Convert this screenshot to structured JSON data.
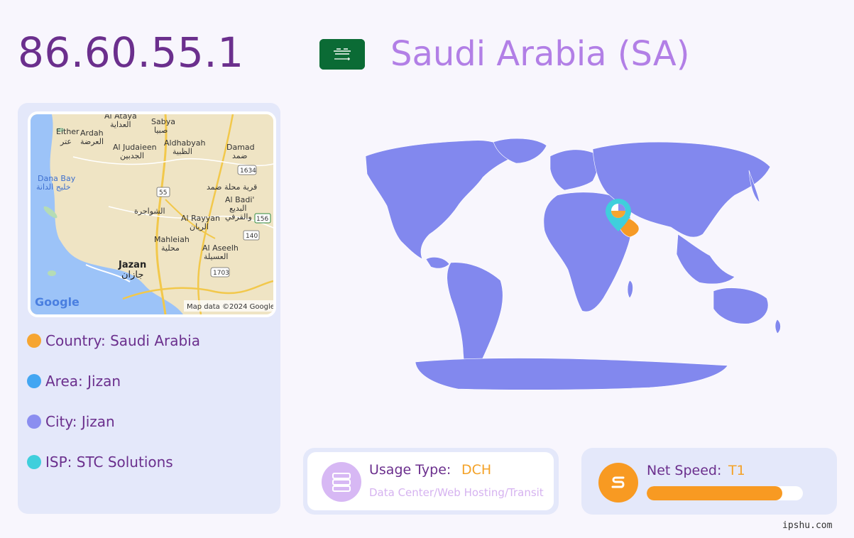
{
  "header": {
    "ip": "86.60.55.1",
    "country_title": "Saudi Arabia (SA)",
    "flag_icon": "saudi-arabia-flag"
  },
  "details": {
    "country": "Country: Saudi Arabia",
    "area": "Area: Jizan",
    "city": "City: Jizan",
    "isp": "ISP: STC Solutions"
  },
  "colors": {
    "country_dot": "#f6a531",
    "area_dot": "#43a6f2",
    "city_dot": "#8b8ef0",
    "isp_dot": "#3fcfdc",
    "world_land": "#8288ee",
    "highlight": "#f69a25",
    "accent_purple": "#6b2f8d"
  },
  "map": {
    "labels": [
      {
        "text": "Al Ataya",
        "id": "al-ataya"
      },
      {
        "text": "العداية",
        "id": "al-ataya-ar"
      },
      {
        "text": "Sabya",
        "id": "sabya"
      },
      {
        "text": "صبيا",
        "id": "sabya-ar"
      },
      {
        "text": "Either",
        "id": "either"
      },
      {
        "text": "Ardah",
        "id": "ardah"
      },
      {
        "text": "عتر",
        "id": "either-ar"
      },
      {
        "text": "العرضة",
        "id": "ardah-ar"
      },
      {
        "text": "Al Judaieen",
        "id": "al-judaieen"
      },
      {
        "text": "الجدبين",
        "id": "al-judaieen-ar"
      },
      {
        "text": "Aldhabyah",
        "id": "aldhabyah"
      },
      {
        "text": "الظبية",
        "id": "aldhabyah-ar"
      },
      {
        "text": "Damad",
        "id": "damad"
      },
      {
        "text": "ضمد",
        "id": "damad-ar"
      },
      {
        "text": "Dana Bay",
        "id": "dana-bay"
      },
      {
        "text": "خليج الدانة",
        "id": "dana-bay-ar"
      },
      {
        "text": "قرية محلة ضمد",
        "id": "qaryat-ar"
      },
      {
        "text": "Al Badi'",
        "id": "al-badi"
      },
      {
        "text": "البديع",
        "id": "al-badi-ar"
      },
      {
        "text": "والقرفي",
        "id": "al-qarfi-ar"
      },
      {
        "text": "الشواجرة",
        "id": "shawajira-ar"
      },
      {
        "text": "Al Rayyan",
        "id": "al-rayyan"
      },
      {
        "text": "الريان",
        "id": "al-rayyan-ar"
      },
      {
        "text": "Mahleiah",
        "id": "mahleiah"
      },
      {
        "text": "محلية",
        "id": "mahleiah-ar"
      },
      {
        "text": "Al Aseelh",
        "id": "al-aseelh"
      },
      {
        "text": "العسيلة",
        "id": "al-aseelh-ar"
      },
      {
        "text": "Jazan",
        "id": "jazan"
      },
      {
        "text": "جازان",
        "id": "jazan-ar"
      }
    ],
    "road_shields": [
      "1634",
      "55",
      "156",
      "140",
      "1703"
    ],
    "logo": "Google",
    "attribution": "Map data ©2024 Google"
  },
  "usage": {
    "label": "Usage Type:",
    "value": "DCH",
    "description": "Data Center/Web Hosting/Transit",
    "icon": "server-icon"
  },
  "speed": {
    "label": "Net Speed:",
    "value": "T1",
    "level_fraction": 0.87,
    "icon": "speed-icon"
  },
  "watermark": "ipshu.com"
}
